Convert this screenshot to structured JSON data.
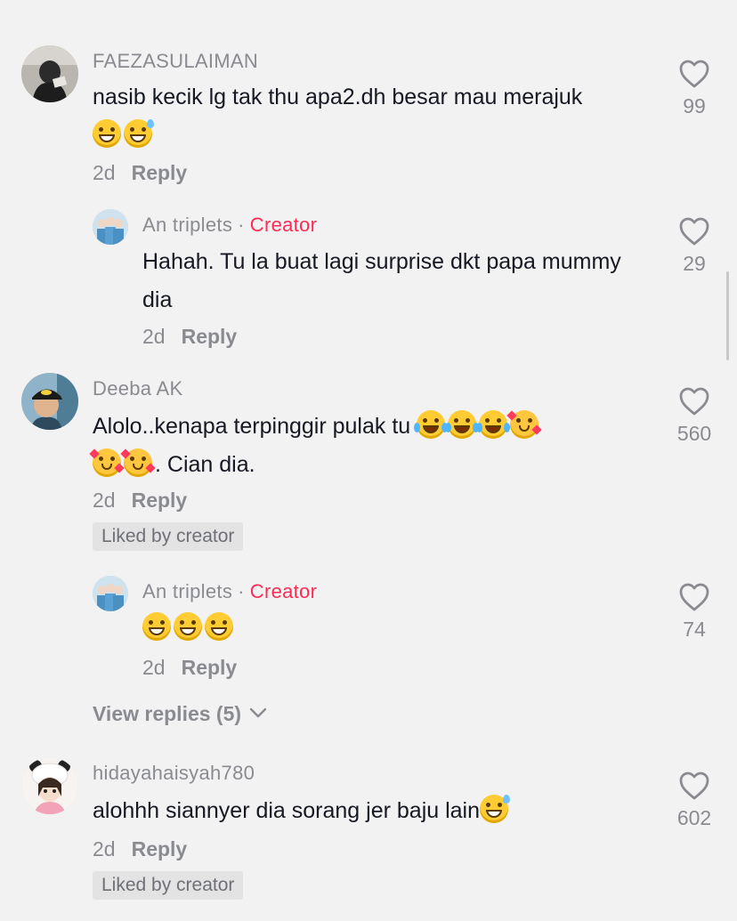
{
  "comments": [
    {
      "username": "FAEZASULAIMAN",
      "text": "nasib kecik lg tak thu apa2.dh besar mau merajuk",
      "emojis": [
        "grin",
        "grin-sweat"
      ],
      "age": "2d",
      "reply_label": "Reply",
      "likes": "99",
      "avatar_icon": "avatar-photo-icon"
    },
    {
      "username": "An triplets",
      "separator": "·",
      "creator_label": "Creator",
      "text": "Hahah. Tu la buat lagi surprise dkt papa mummy dia",
      "age": "2d",
      "reply_label": "Reply",
      "likes": "29",
      "avatar_icon": "triplets-avatar-icon"
    },
    {
      "username": "Deeba AK",
      "text_1": "Alolo..kenapa terpinggir pulak tu",
      "text_2": ". Cian dia.",
      "emojis_1": [
        "tears-of-joy",
        "tears-of-joy",
        "tears-of-joy",
        "smiling-hearts"
      ],
      "emojis_2": [
        "smiling-hearts",
        "smiling-hearts"
      ],
      "age": "2d",
      "reply_label": "Reply",
      "liked_by_creator": "Liked by creator",
      "likes": "560",
      "avatar_icon": "batman-cap-avatar-icon"
    },
    {
      "username": "An triplets",
      "separator": "·",
      "creator_label": "Creator",
      "emojis": [
        "grin",
        "grin",
        "grin"
      ],
      "age": "2d",
      "reply_label": "Reply",
      "likes": "74",
      "avatar_icon": "triplets-avatar-icon"
    },
    {
      "username": "hidayahaisyah780",
      "text": "alohhh siannyer dia sorang jer baju lain",
      "emojis": [
        "grin-sweat"
      ],
      "age": "2d",
      "reply_label": "Reply",
      "liked_by_creator": "Liked by creator",
      "likes": "602",
      "avatar_icon": "panda-girl-avatar-icon"
    }
  ],
  "view_replies": "View replies (5)",
  "colors": {
    "background": "#f2f2f2",
    "creator": "#fe2c55",
    "muted": "#8a8b91",
    "text": "#161823"
  },
  "icons": {
    "like": "heart-outline-icon",
    "chevron": "chevron-down-icon"
  }
}
